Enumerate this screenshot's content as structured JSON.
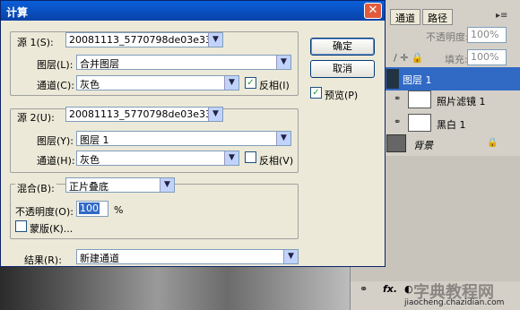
{
  "dialog": {
    "title": "计算",
    "close_glyph": "✕",
    "ok_label": "确定",
    "cancel_label": "取消",
    "preview_label": "预览(P)",
    "preview_checked": true,
    "source1": {
      "label": "源 1(S):",
      "file": "20081113_5770798de03e33...",
      "layer_label": "图层(L):",
      "layer": "合并图层",
      "channel_label": "通道(C):",
      "channel": "灰色",
      "invert_label": "反相(I)",
      "invert_checked": true
    },
    "source2": {
      "label": "源 2(U):",
      "file": "20081113_5770798de03e33...",
      "layer_label": "图层(Y):",
      "layer": "图层 1",
      "channel_label": "通道(H):",
      "channel": "灰色",
      "invert_label": "反相(V)",
      "invert_checked": false
    },
    "blend": {
      "label": "混合(B):",
      "mode": "正片叠底",
      "opacity_label": "不透明度(O):",
      "opacity_value": "100",
      "opacity_unit": "%",
      "mask_label": "蒙版(K)...",
      "mask_checked": false
    },
    "result_label": "结果(R):",
    "result": "新建通道"
  },
  "panel": {
    "tabs": [
      "通道",
      "路径"
    ],
    "opacity_label": "不透明度:",
    "opacity_value": "100%",
    "fill_label": "填充:",
    "fill_value": "100%",
    "layers": [
      {
        "name": "图层 1",
        "selected": true
      },
      {
        "name": "照片滤镜 1",
        "selected": false
      },
      {
        "name": "黑白 1",
        "selected": false
      },
      {
        "name": "背景",
        "selected": false
      }
    ],
    "bottom_icons": [
      "link-icon",
      "fx-icon",
      "mask-icon"
    ]
  },
  "watermark": "jiaocheng.chazidian.com",
  "watermark_cn": "字典教程网",
  "icons": {
    "dropdown": "▼",
    "check": "✓",
    "eye": "👁",
    "lock": "🔒"
  }
}
